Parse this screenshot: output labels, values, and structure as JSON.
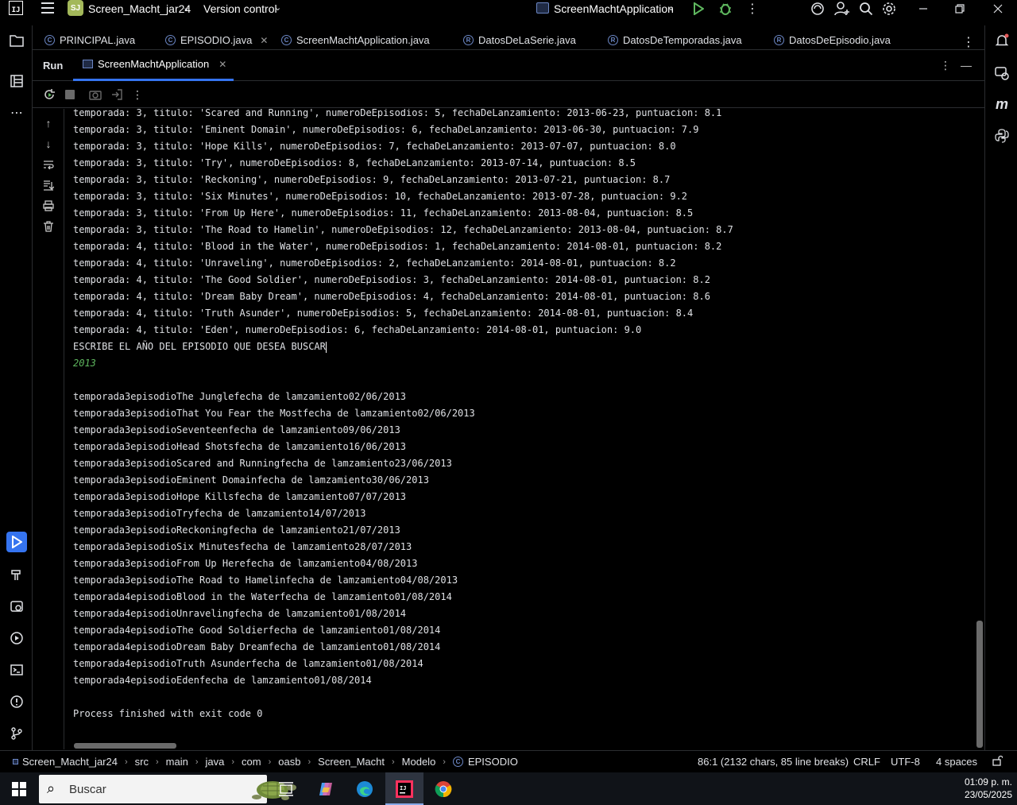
{
  "titlebar": {
    "project_badge": "SJ",
    "project_name": "Screen_Macht_jar24",
    "version_control": "Version control",
    "run_config": "ScreenMachtApplication"
  },
  "editor_tabs": [
    {
      "label": "PRINCIPAL.java",
      "closable": false
    },
    {
      "label": "EPISODIO.java",
      "closable": true
    },
    {
      "label": "ScreenMachtApplication.java",
      "closable": false
    },
    {
      "label": "DatosDeLaSerie.java",
      "closable": false
    },
    {
      "label": "DatosDeTemporadas.java",
      "closable": false
    },
    {
      "label": "DatosDeEpisodio.java",
      "closable": false
    }
  ],
  "run_panel": {
    "label": "Run",
    "tab_label": "ScreenMachtApplication"
  },
  "console": {
    "lines": [
      "temporada: 3, titulo: 'Scared and Running', numeroDeEpisodios: 5, fechaDeLanzamiento: 2013-06-23, puntuacion: 8.1",
      "temporada: 3, titulo: 'Eminent Domain', numeroDeEpisodios: 6, fechaDeLanzamiento: 2013-06-30, puntuacion: 7.9",
      "temporada: 3, titulo: 'Hope Kills', numeroDeEpisodios: 7, fechaDeLanzamiento: 2013-07-07, puntuacion: 8.0",
      "temporada: 3, titulo: 'Try', numeroDeEpisodios: 8, fechaDeLanzamiento: 2013-07-14, puntuacion: 8.5",
      "temporada: 3, titulo: 'Reckoning', numeroDeEpisodios: 9, fechaDeLanzamiento: 2013-07-21, puntuacion: 8.7",
      "temporada: 3, titulo: 'Six Minutes', numeroDeEpisodios: 10, fechaDeLanzamiento: 2013-07-28, puntuacion: 9.2",
      "temporada: 3, titulo: 'From Up Here', numeroDeEpisodios: 11, fechaDeLanzamiento: 2013-08-04, puntuacion: 8.5",
      "temporada: 3, titulo: 'The Road to Hamelin', numeroDeEpisodios: 12, fechaDeLanzamiento: 2013-08-04, puntuacion: 8.7",
      "temporada: 4, titulo: 'Blood in the Water', numeroDeEpisodios: 1, fechaDeLanzamiento: 2014-08-01, puntuacion: 8.2",
      "temporada: 4, titulo: 'Unraveling', numeroDeEpisodios: 2, fechaDeLanzamiento: 2014-08-01, puntuacion: 8.2",
      "temporada: 4, titulo: 'The Good Soldier', numeroDeEpisodios: 3, fechaDeLanzamiento: 2014-08-01, puntuacion: 8.2",
      "temporada: 4, titulo: 'Dream Baby Dream', numeroDeEpisodios: 4, fechaDeLanzamiento: 2014-08-01, puntuacion: 8.6",
      "temporada: 4, titulo: 'Truth Asunder', numeroDeEpisodios: 5, fechaDeLanzamiento: 2014-08-01, puntuacion: 8.4",
      "temporada: 4, titulo: 'Eden', numeroDeEpisodios: 6, fechaDeLanzamiento: 2014-08-01, puntuacion: 9.0"
    ],
    "prompt": "ESCRIBE EL AÑO DEL EPISODIO QUE DESEA BUSCAR",
    "user_input": "2013",
    "results": [
      "temporada3episodioThe Junglefecha de lamzamiento02/06/2013",
      "temporada3episodioThat You Fear the Mostfecha de lamzamiento02/06/2013",
      "temporada3episodioSeventeenfecha de lamzamiento09/06/2013",
      "temporada3episodioHead Shotsfecha de lamzamiento16/06/2013",
      "temporada3episodioScared and Runningfecha de lamzamiento23/06/2013",
      "temporada3episodioEminent Domainfecha de lamzamiento30/06/2013",
      "temporada3episodioHope Killsfecha de lamzamiento07/07/2013",
      "temporada3episodioTryfecha de lamzamiento14/07/2013",
      "temporada3episodioReckoningfecha de lamzamiento21/07/2013",
      "temporada3episodioSix Minutesfecha de lamzamiento28/07/2013",
      "temporada3episodioFrom Up Herefecha de lamzamiento04/08/2013",
      "temporada3episodioThe Road to Hamelinfecha de lamzamiento04/08/2013",
      "temporada4episodioBlood in the Waterfecha de lamzamiento01/08/2014",
      "temporada4episodioUnravelingfecha de lamzamiento01/08/2014",
      "temporada4episodioThe Good Soldierfecha de lamzamiento01/08/2014",
      "temporada4episodioDream Baby Dreamfecha de lamzamiento01/08/2014",
      "temporada4episodioTruth Asunderfecha de lamzamiento01/08/2014",
      "temporada4episodioEdenfecha de lamzamiento01/08/2014"
    ],
    "exit_message": "Process finished with exit code 0"
  },
  "statusbar": {
    "breadcrumbs": [
      "Screen_Macht_jar24",
      "src",
      "main",
      "java",
      "com",
      "oasb",
      "Screen_Macht",
      "Modelo"
    ],
    "current_class": "EPISODIO",
    "position": "86:1 (2132 chars, 85 line breaks)",
    "line_separator": "CRLF",
    "encoding": "UTF-8",
    "indent": "4 spaces"
  },
  "taskbar": {
    "search_placeholder": "Buscar",
    "time": "01:09 p. m.",
    "date": "23/05/2025"
  },
  "colors": {
    "accent": "#3574f0",
    "input_text": "#5fb85f",
    "background": "#000000"
  }
}
